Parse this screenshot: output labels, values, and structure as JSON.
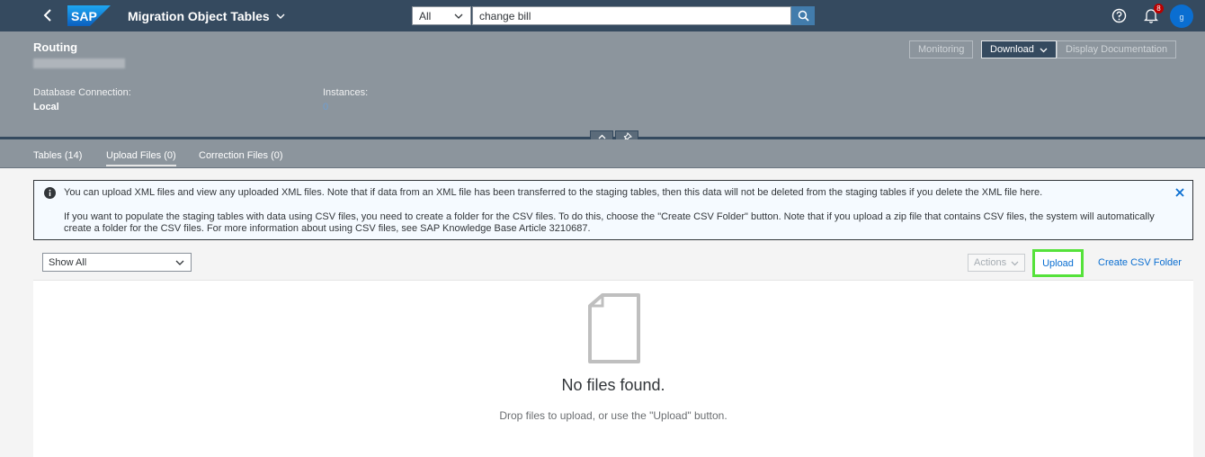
{
  "shell": {
    "logo_text": "SAP",
    "title": "Migration Object Tables",
    "search_scope": "All",
    "search_value": "change bill",
    "notification_count": "8",
    "avatar_initial": "g"
  },
  "header": {
    "title": "Routing",
    "buttons": {
      "monitoring": "Monitoring",
      "download": "Download",
      "display_doc": "Display Documentation"
    },
    "attributes": {
      "db_label": "Database Connection:",
      "db_value": "Local",
      "instances_label": "Instances:",
      "instances_value": "0"
    }
  },
  "tabs": [
    {
      "label": "Tables (14)"
    },
    {
      "label": "Upload Files (0)"
    },
    {
      "label": "Correction Files (0)"
    }
  ],
  "message": {
    "line1": "You can upload XML files and view any uploaded XML files. Note that if data from an XML file has been transferred to the staging tables, then this data will not be deleted from the staging tables if you delete the XML file here.",
    "line2": "If you want to populate the staging tables with data using CSV files, you need to create a folder for the CSV files. To do this, choose the \"Create CSV Folder\" button. Note that if you upload a zip file that contains CSV files, the system will automatically create a folder for the CSV files. For more information about using CSV files, see SAP Knowledge Base Article 3210687."
  },
  "toolbar": {
    "filter_value": "Show All",
    "actions_label": "Actions",
    "upload_label": "Upload",
    "create_csv_label": "Create CSV Folder"
  },
  "empty": {
    "title": "No files found.",
    "subtitle": "Drop files to upload, or use the \"Upload\" button."
  },
  "colors": {
    "shell_bg": "#354a5f",
    "header_bg": "#8c959d",
    "link": "#0a6ed1",
    "highlight": "#55e23a"
  }
}
